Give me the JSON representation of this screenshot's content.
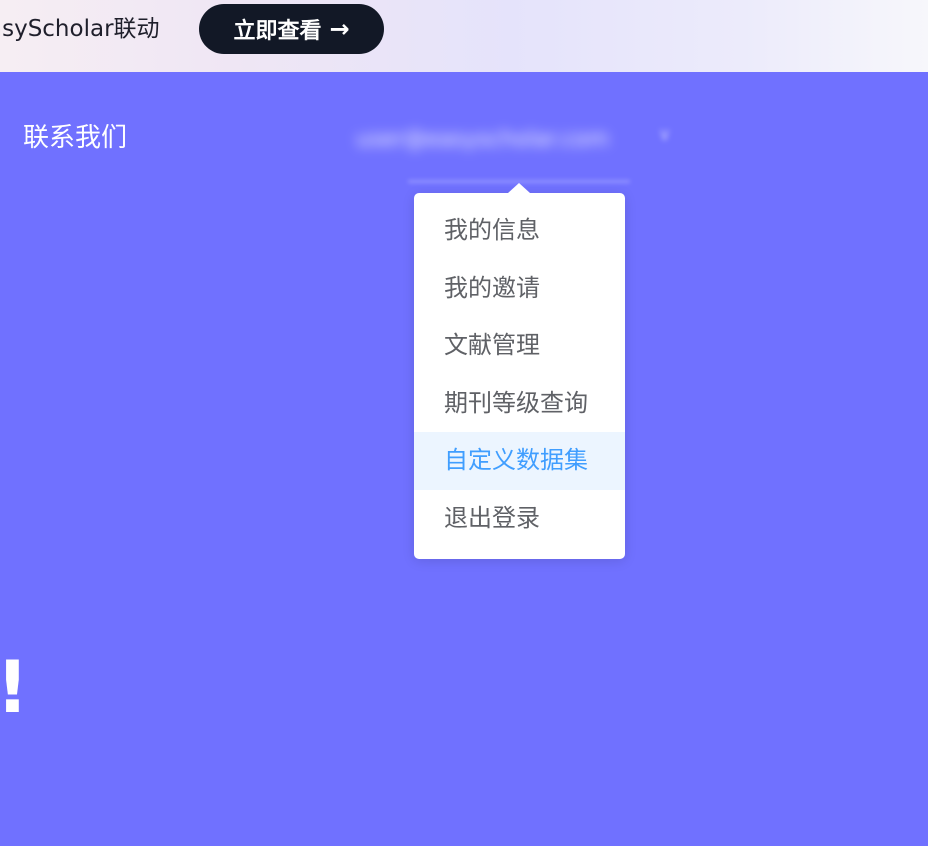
{
  "banner": {
    "text": "asyScholar联动",
    "button_label": "立即查看",
    "button_arrow": "→"
  },
  "header": {
    "nav_contact": "联系我们",
    "user_email": "user@easyscholar.com",
    "user_caret": "∨"
  },
  "dropdown": {
    "items": [
      {
        "label": "我的信息"
      },
      {
        "label": "我的邀请"
      },
      {
        "label": "文献管理"
      },
      {
        "label": "期刊等级查询"
      },
      {
        "label": "自定义数据集"
      },
      {
        "label": "退出登录"
      }
    ],
    "active_index": 4
  },
  "hero": {
    "fragment": "!"
  },
  "colors": {
    "background": "#7071ff",
    "active_text": "#409eff",
    "active_bg": "#ecf5ff",
    "button_bg": "#121826"
  }
}
